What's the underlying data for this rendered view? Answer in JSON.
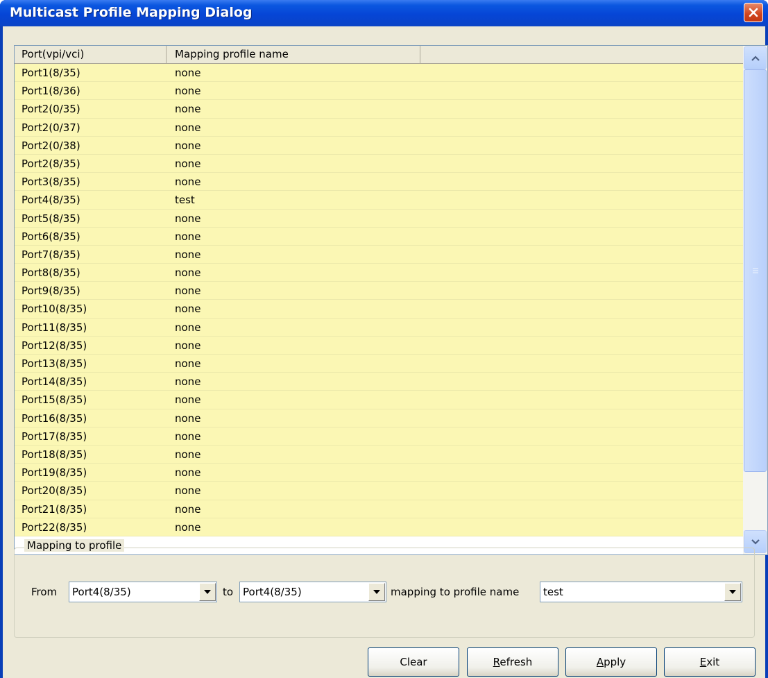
{
  "window": {
    "title": "Multicast Profile Mapping Dialog",
    "close_icon": "close-icon",
    "accent": "#0645d6"
  },
  "table": {
    "columns": [
      "Port(vpi/vci)",
      "Mapping profile name",
      ""
    ],
    "row_color": "#fbf7b4",
    "rows": [
      [
        "Port1(8/35)",
        "none"
      ],
      [
        "Port1(8/36)",
        "none"
      ],
      [
        "Port2(0/35)",
        "none"
      ],
      [
        "Port2(0/37)",
        "none"
      ],
      [
        "Port2(0/38)",
        "none"
      ],
      [
        "Port2(8/35)",
        "none"
      ],
      [
        "Port3(8/35)",
        "none"
      ],
      [
        "Port4(8/35)",
        "test"
      ],
      [
        "Port5(8/35)",
        "none"
      ],
      [
        "Port6(8/35)",
        "none"
      ],
      [
        "Port7(8/35)",
        "none"
      ],
      [
        "Port8(8/35)",
        "none"
      ],
      [
        "Port9(8/35)",
        "none"
      ],
      [
        "Port10(8/35)",
        "none"
      ],
      [
        "Port11(8/35)",
        "none"
      ],
      [
        "Port12(8/35)",
        "none"
      ],
      [
        "Port13(8/35)",
        "none"
      ],
      [
        "Port14(8/35)",
        "none"
      ],
      [
        "Port15(8/35)",
        "none"
      ],
      [
        "Port16(8/35)",
        "none"
      ],
      [
        "Port17(8/35)",
        "none"
      ],
      [
        "Port18(8/35)",
        "none"
      ],
      [
        "Port19(8/35)",
        "none"
      ],
      [
        "Port20(8/35)",
        "none"
      ],
      [
        "Port21(8/35)",
        "none"
      ],
      [
        "Port22(8/35)",
        "none"
      ]
    ]
  },
  "mapping": {
    "legend": "Mapping to profile",
    "from_label": "From",
    "from_value": "Port4(8/35)",
    "to_label": "to",
    "to_value": "Port4(8/35)",
    "profile_label": "mapping to profile name",
    "profile_value": "test"
  },
  "buttons": {
    "clear": "Clear",
    "refresh_u": "R",
    "refresh_rest": "efresh",
    "apply_u": "A",
    "apply_rest": "pply",
    "exit_u": "E",
    "exit_rest": "xit"
  }
}
